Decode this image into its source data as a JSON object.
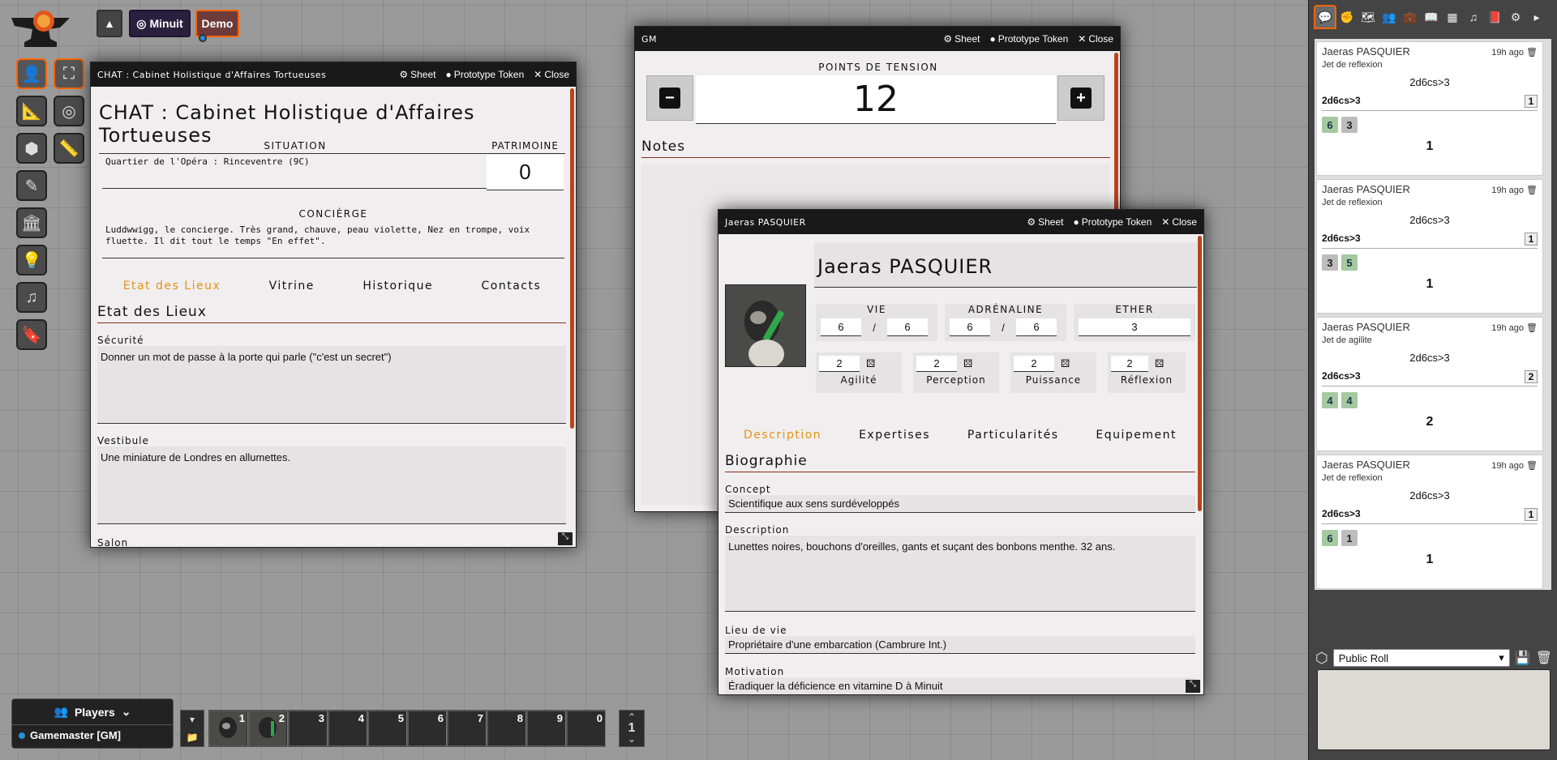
{
  "top": {
    "user1": "Minuit",
    "user2": "Demo"
  },
  "chat_sheet": {
    "header_title": "CHAT : Cabinet Holistique d'Affaires Tortueuses",
    "sheet_btn": "Sheet",
    "proto_btn": "Prototype Token",
    "close_btn": "Close",
    "name": "CHAT : Cabinet Holistique d'Affaires Tortueuses",
    "situation_label": "SITUATION",
    "situation_value": "Quartier de l'Opéra : Rinceventre (9C)",
    "patrimoine_label": "PATRIMOINE",
    "patrimoine_value": "0",
    "concierge_label": "CONCIÈRGE",
    "concierge_value": "Luddwwigg, le concierge. Très grand, chauve, peau violette, Nez en trompe, voix fluette. Il dit tout le temps \"En effet\".",
    "tabs": [
      "Etat des Lieux",
      "Vitrine",
      "Historique",
      "Contacts"
    ],
    "section_title": "Etat des Lieux",
    "securite_label": "Sécurité",
    "securite_value": "Donner un mot de passe à la porte qui parle (\"c'est un secret\")",
    "vestibule_label": "Vestibule",
    "vestibule_value": "Une miniature de Londres en allumettes.",
    "salon_label": "Salon"
  },
  "gm_sheet": {
    "header_title": "GM",
    "sheet_btn": "Sheet",
    "proto_btn": "Prototype Token",
    "close_btn": "Close",
    "tension_label": "POINTS DE TENSION",
    "tension_value": "12",
    "notes_label": "Notes"
  },
  "char_sheet": {
    "header_title": "Jaeras PASQUIER",
    "sheet_btn": "Sheet",
    "proto_btn": "Prototype Token",
    "close_btn": "Close",
    "name": "Jaeras PASQUIER",
    "vie_label": "VIE",
    "vie_cur": "6",
    "vie_max": "6",
    "sep": "/",
    "adr_label": "ADRÉNALINE",
    "adr_cur": "6",
    "adr_max": "6",
    "ether_label": "ETHER",
    "ether_value": "3",
    "attrs": [
      {
        "label": "Agilité",
        "value": "2"
      },
      {
        "label": "Perception",
        "value": "2"
      },
      {
        "label": "Puissance",
        "value": "2"
      },
      {
        "label": "Réflexion",
        "value": "2"
      }
    ],
    "tabs": [
      "Description",
      "Expertises",
      "Particularités",
      "Equipement"
    ],
    "section_title": "Biographie",
    "concept_label": "Concept",
    "concept_value": "Scientifique aux sens surdéveloppés",
    "desc_label": "Description",
    "desc_value": "Lunettes noires, bouchons d'oreilles, gants et suçant des bonbons menthe. 32 ans.",
    "lieu_label": "Lieu de vie",
    "lieu_value": "Propriétaire d'une embarcation (Cambrure Int.)",
    "motiv_label": "Motivation",
    "motiv_value": "Éradiquer la déficience en vitamine D à Minuit"
  },
  "chat": {
    "messages": [
      {
        "who": "Jaeras PASQUIER",
        "ago": "19h ago",
        "flavor": "Jet de reflexion",
        "formula": "2d6cs>3",
        "total": "1",
        "dice": [
          {
            "v": "6",
            "ok": true
          },
          {
            "v": "3",
            "ok": false
          }
        ],
        "result": "1"
      },
      {
        "who": "Jaeras PASQUIER",
        "ago": "19h ago",
        "flavor": "Jet de reflexion",
        "formula": "2d6cs>3",
        "total": "1",
        "dice": [
          {
            "v": "3",
            "ok": false
          },
          {
            "v": "5",
            "ok": true
          }
        ],
        "result": "1"
      },
      {
        "who": "Jaeras PASQUIER",
        "ago": "19h ago",
        "flavor": "Jet de agilite",
        "formula": "2d6cs>3",
        "total": "2",
        "dice": [
          {
            "v": "4",
            "ok": true
          },
          {
            "v": "4",
            "ok": true
          }
        ],
        "result": "2"
      },
      {
        "who": "Jaeras PASQUIER",
        "ago": "19h ago",
        "flavor": "Jet de reflexion",
        "formula": "2d6cs>3",
        "total": "1",
        "dice": [
          {
            "v": "6",
            "ok": true
          },
          {
            "v": "1",
            "ok": false
          }
        ],
        "result": "1"
      }
    ],
    "roll_mode": "Public Roll"
  },
  "players": {
    "title": "Players",
    "gm": "Gamemaster [GM]"
  },
  "hotbar": {
    "slots": [
      "1",
      "2",
      "3",
      "4",
      "5",
      "6",
      "7",
      "8",
      "9",
      "0"
    ],
    "page": "1"
  }
}
